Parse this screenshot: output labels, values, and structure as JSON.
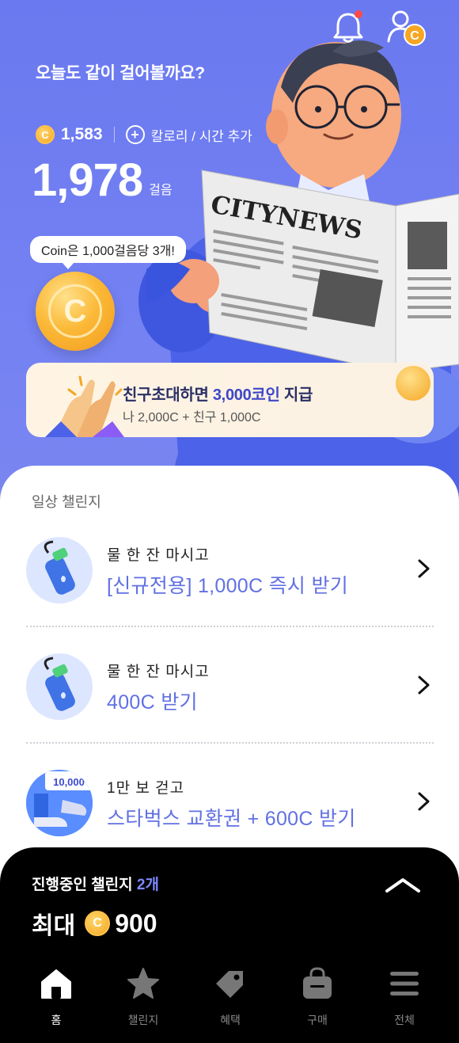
{
  "header": {
    "greeting": "오늘도 같이 걸어볼까요?",
    "coin_symbol": "C",
    "coin_balance": "1,583",
    "add_label": "칼로리 / 시간 추가",
    "steps": "1,978",
    "steps_unit": "걸음",
    "bubble": "Coin은 1,000걸음당 3개!",
    "big_coin_symbol": "C",
    "illustration_text": "CITYNEWS"
  },
  "promo": {
    "title_prefix": "친구초대하면 ",
    "title_highlight": "3,000코인",
    "title_suffix": " 지급",
    "subtitle": "나 2,000C + 친구 1,000C"
  },
  "challenges": {
    "section_title": "일상 챌린지",
    "items": [
      {
        "line1": "물 한 잔 마시고",
        "line2": "[신규전용] 1,000C 즉시 받기",
        "thumb": "water-bottle"
      },
      {
        "line1": "물 한 잔 마시고",
        "line2": "400C 받기",
        "thumb": "water-bottle"
      },
      {
        "line1": "1만 보 걷고",
        "line2": "스타벅스 교환권 + 600C 받기",
        "thumb": "walking-shoes",
        "badge": "10,000"
      }
    ]
  },
  "panel": {
    "title": "진행중인 챌린지 ",
    "count": "2개",
    "max_label": "최대",
    "max_value": "900"
  },
  "tabs": [
    {
      "label": "홈",
      "icon": "home-icon",
      "active": true
    },
    {
      "label": "챌린지",
      "icon": "star-icon",
      "active": false
    },
    {
      "label": "혜택",
      "icon": "tag-icon",
      "active": false
    },
    {
      "label": "구매",
      "icon": "shopping-bag-icon",
      "active": false
    },
    {
      "label": "전체",
      "icon": "menu-icon",
      "active": false
    }
  ],
  "colors": {
    "hero_bg": "#6f7df0",
    "accent": "#6170e3",
    "coin": "#f4a623",
    "notification_dot": "#ff4a4a"
  }
}
